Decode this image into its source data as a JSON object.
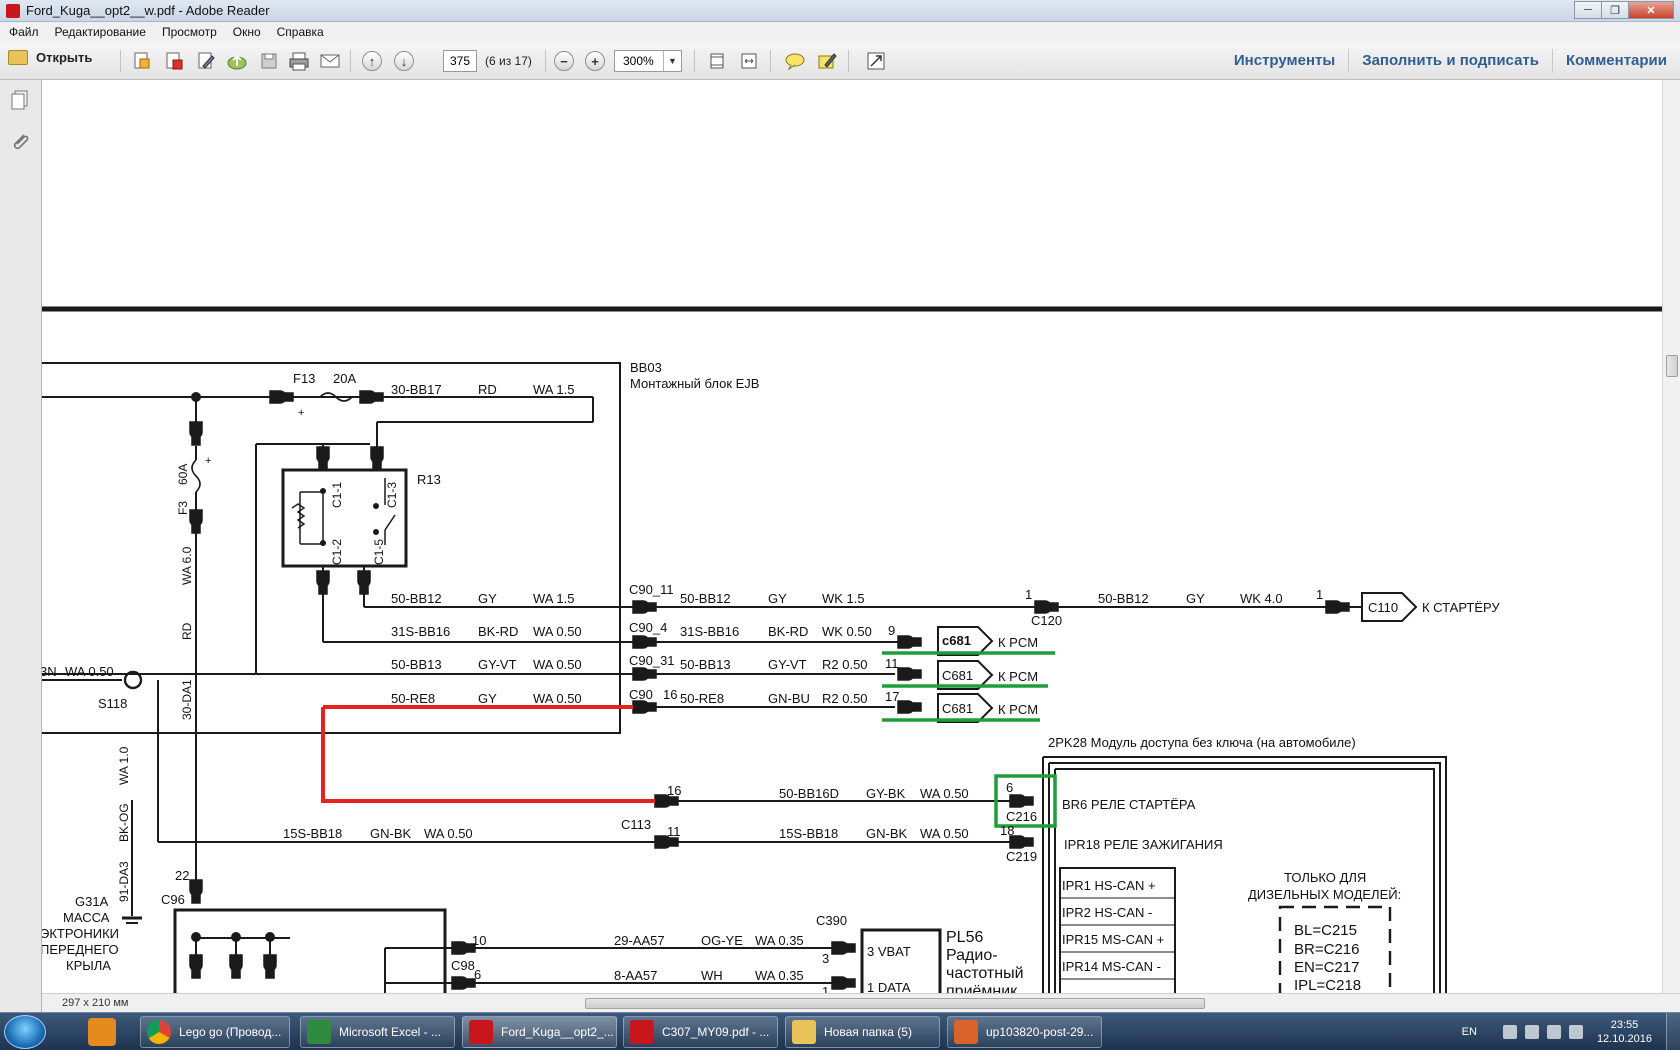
{
  "window": {
    "title": "Ford_Kuga__opt2__w.pdf - Adobe Reader"
  },
  "menu": [
    "Файл",
    "Редактирование",
    "Просмотр",
    "Окно",
    "Справка"
  ],
  "toolbar": {
    "open_label": "Открыть",
    "page_number": "375",
    "page_count": "(6 из 17)",
    "zoom": "300%",
    "right_tools": [
      "Инструменты",
      "Заполнить и подписать",
      "Комментарии"
    ]
  },
  "status": {
    "page_size": "297 x 210 мм"
  },
  "diagram": {
    "block_name": "BB03",
    "block_desc": "Монтажный блок EJB",
    "fuse_f13": "F13",
    "fuse_f13_rating": "20A",
    "fuse_f3": "F3",
    "fuse_f3_rating": "60A",
    "relay": "R13",
    "relay_pins": [
      "C1-1",
      "C1-3",
      "C1-2",
      "C1-5"
    ],
    "wire_top": {
      "code": "30-BB17",
      "color": "RD",
      "spec": "WA  1.5"
    },
    "wire_vertical": {
      "spec": "WA 6.0",
      "color": "RD",
      "code": "30-DA1"
    },
    "wire_left_vertical": {
      "spec": "WA 1.0",
      "color": "BK-OG",
      "code": "91-DA3"
    },
    "splice": "S118",
    "left_wire": {
      "suffix": "3N",
      "spec": "WA 0.50"
    },
    "rows": [
      {
        "l_code": "50-BB12",
        "l_color": "GY",
        "l_spec": "WA  1.5",
        "conn": "C90_11",
        "r_code": "50-BB12",
        "r_color": "GY",
        "r_spec": "WK  1.5"
      },
      {
        "l_code": "31S-BB16",
        "l_color": "BK-RD",
        "l_spec": "WA  0.50",
        "conn": "C90_4",
        "r_code": "31S-BB16",
        "r_color": "BK-RD",
        "r_spec": "WK  0.50",
        "pin": "9",
        "dest": "c681",
        "dest_label": "К PCM"
      },
      {
        "l_code": "50-BB13",
        "l_color": "GY-VT",
        "l_spec": "WA  0.50",
        "conn": "C90_31",
        "r_code": "50-BB13",
        "r_color": "GY-VT",
        "r_spec": "R2  0.50",
        "pin": "11",
        "dest": "C681",
        "dest_label": "К PCM"
      },
      {
        "l_code": "50-RE8",
        "l_color": "GY",
        "l_spec": "WA  0.50",
        "conn": "C90",
        "conn_pin": "16",
        "r_code": "50-RE8",
        "r_color": "GN-BU",
        "r_spec": "R2  0.50",
        "pin": "17",
        "dest": "C681",
        "dest_label": "К PCM"
      }
    ],
    "c120": {
      "pin": "1",
      "name": "C120",
      "code": "50-BB12",
      "color": "GY",
      "spec": "WK 4.0",
      "pin2": "1",
      "dest": "C110",
      "dest_label": "К СТАРТЁРУ"
    },
    "module_title": "2PK28  Модуль доступа без ключа (на автомобиле)",
    "c113": {
      "name": "C113",
      "pin_a": "16",
      "pin_b": "11"
    },
    "bb16d": {
      "code": "50-BB16D",
      "color": "GY-BK",
      "spec": "WA  0.50",
      "pin": "6",
      "conn": "C216",
      "label": "BR6  РЕЛЕ СТАРТЁРА"
    },
    "bb18": {
      "l_code": "15S-BB18",
      "l_color": "GN-BK",
      "l_spec": "WA  0.50",
      "r_code": "15S-BB18",
      "r_color": "GN-BK",
      "r_spec": "WA  0.50",
      "pin": "18",
      "conn": "C219",
      "label": "IPR18 РЕЛЕ ЗАЖИГАНИЯ"
    },
    "ipr": [
      "IPR1   HS-CAN +",
      "IPR2   HS-CAN -",
      "IPR15  MS-CAN +",
      "IPR14  MS-CAN -"
    ],
    "diesel_title": [
      "ТОЛЬКО ДЛЯ",
      "ДИЗЕЛЬНЫХ МОДЕЛЕЙ:"
    ],
    "diesel_items": [
      "BL=C215",
      "BR=C216",
      "EN=C217",
      "IPL=C218"
    ],
    "ground": {
      "name": "G31A",
      "lines": [
        "МАССА",
        "ЭКТРОНИКИ",
        "ПЕРЕДНЕГО",
        "КРЫЛА"
      ]
    },
    "c96": {
      "name": "C96",
      "pin": "22"
    },
    "c98": {
      "name": "C98",
      "pin_a": "10",
      "pin_b": "6"
    },
    "c390": {
      "name": "C390",
      "pin_a": "3",
      "pin_b": "1"
    },
    "aa57": {
      "code": "29-AA57",
      "color": "OG-YE",
      "spec": "WA  0.35"
    },
    "aa57b": {
      "code": "8-AA57",
      "color": "WH",
      "spec": "WA  0.35"
    },
    "pl56": {
      "name": "PL56",
      "lines": [
        "Радио-",
        "частотный",
        "приёмник"
      ],
      "pins": [
        "3  VBAT",
        "1  DATA"
      ]
    }
  },
  "taskbar": {
    "items": [
      {
        "label": "Lego go (Провод...",
        "color": "#e9c23a"
      },
      {
        "label": "Microsoft Excel - ...",
        "color": "#2e8b3e"
      },
      {
        "label": "Ford_Kuga__opt2_...",
        "color": "#c8161d"
      },
      {
        "label": "C307_MY09.pdf - ...",
        "color": "#c8161d"
      },
      {
        "label": "Новая папка (5)",
        "color": "#e8c35a"
      },
      {
        "label": "up103820-post-29...",
        "color": "#d8632b"
      }
    ],
    "lang": "EN",
    "time": "23:55",
    "date": "12.10.2016"
  },
  "colors": {
    "accent_red": "#e52421",
    "highlight_green": "#1f9d3a",
    "link_blue": "#2f5f92"
  }
}
